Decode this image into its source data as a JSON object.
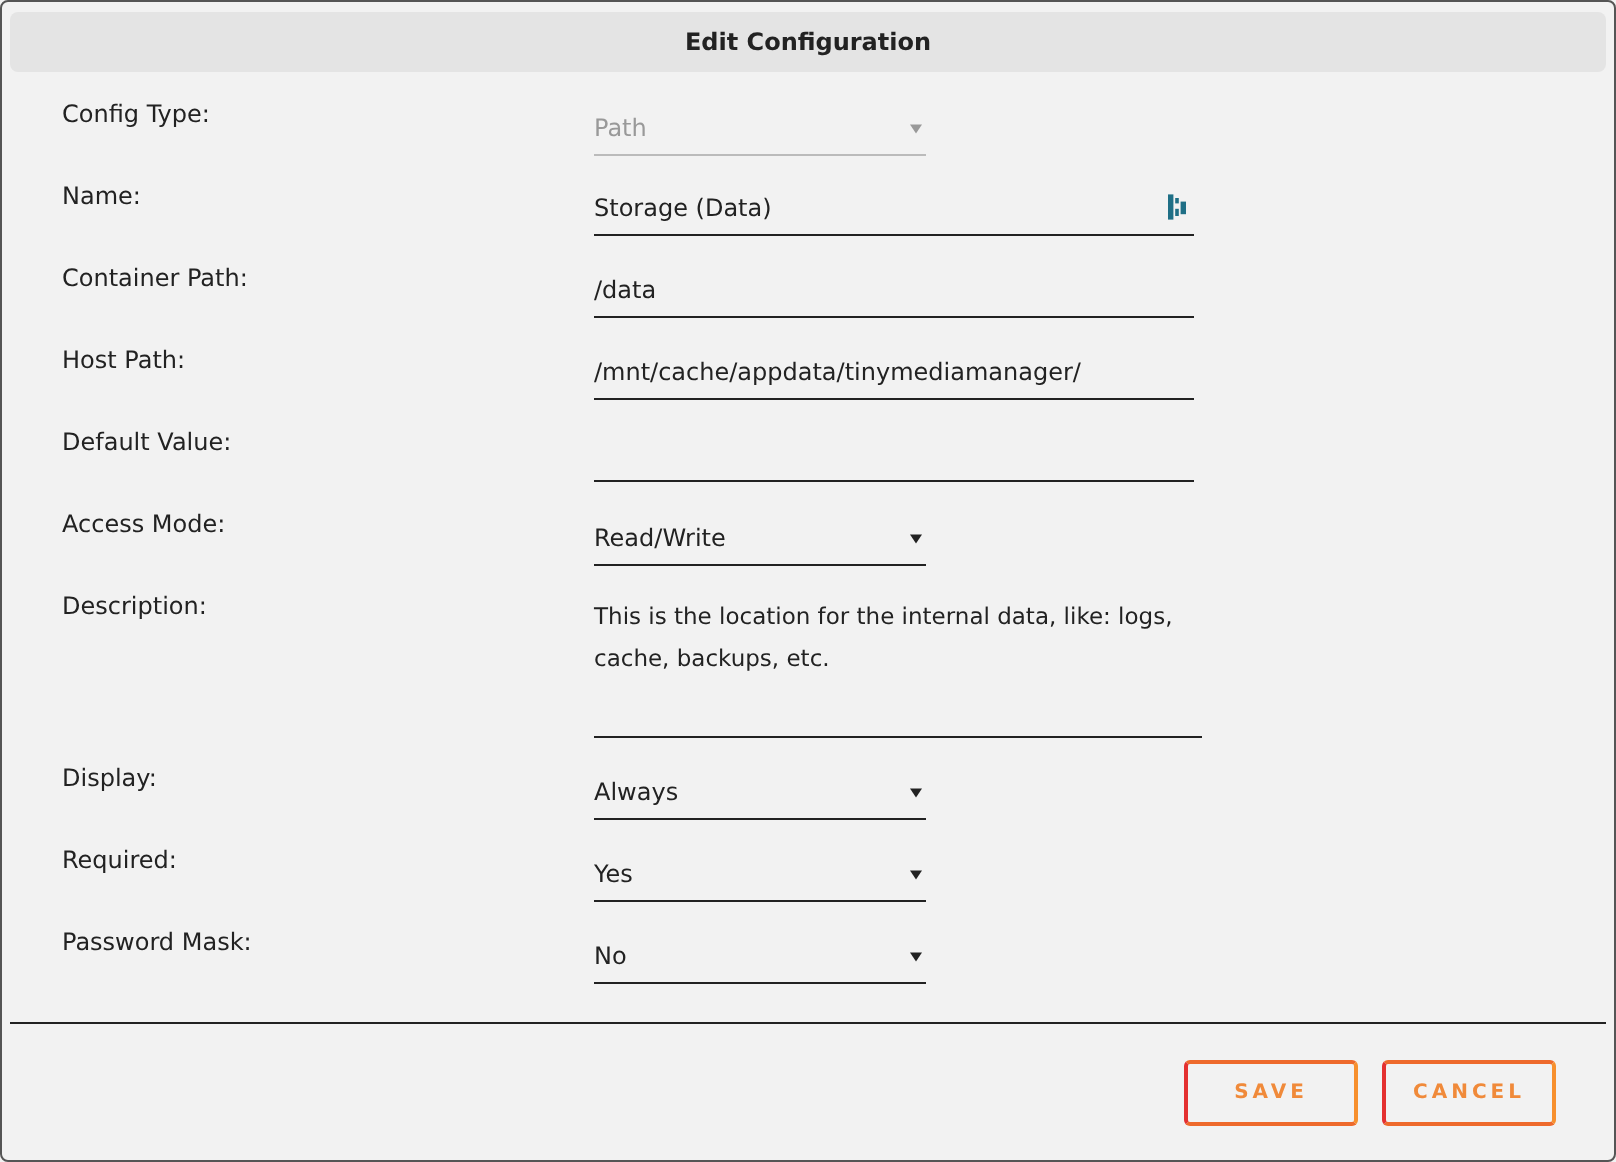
{
  "window": {
    "title": "Edit Configuration"
  },
  "fields": [
    {
      "label": "Config Type:",
      "kind": "select",
      "value": "Path",
      "disabled": true
    },
    {
      "label": "Name:",
      "kind": "text",
      "value": "Storage (Data)",
      "disabled": false,
      "icon": true
    },
    {
      "label": "Container Path:",
      "kind": "text",
      "value": "/data",
      "disabled": false,
      "icon": false
    },
    {
      "label": "Host Path:",
      "kind": "text",
      "value": "/mnt/cache/appdata/tinymediamanager/",
      "disabled": false,
      "icon": false
    },
    {
      "label": "Default Value:",
      "kind": "text",
      "disabled": false,
      "icon": false
    },
    {
      "label": "Access Mode:",
      "kind": "select",
      "value": "Read/Write",
      "disabled": false
    },
    {
      "label": "Description:",
      "kind": "textarea",
      "value": "This is the location for the internal data, like: logs, cache, backups, etc.",
      "disabled": false
    },
    {
      "label": "Display:",
      "kind": "select",
      "value": "Always",
      "disabled": false
    },
    {
      "label": "Required:",
      "kind": "select",
      "value": "Yes",
      "disabled": false
    },
    {
      "label": "Password Mask:",
      "kind": "select",
      "value": "No",
      "disabled": false
    }
  ],
  "buttons": [
    "SAVE",
    "CANCEL"
  ]
}
